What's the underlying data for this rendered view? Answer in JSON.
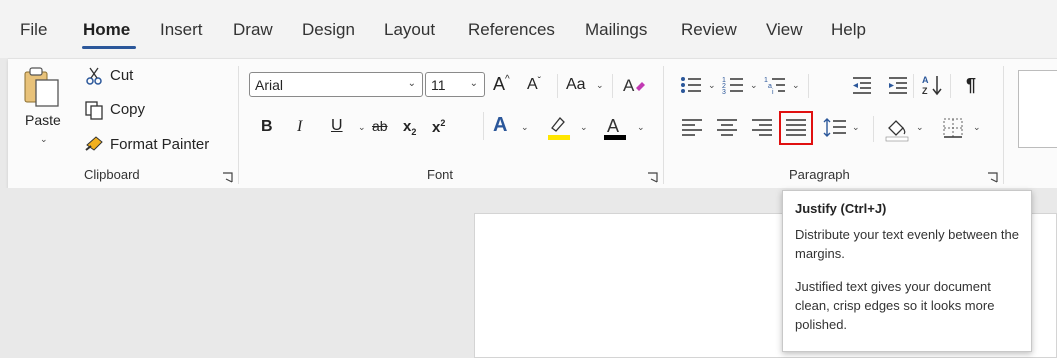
{
  "menu": {
    "tabs": [
      "File",
      "Home",
      "Insert",
      "Draw",
      "Design",
      "Layout",
      "References",
      "Mailings",
      "Review",
      "View",
      "Help"
    ],
    "active_tab": "Home"
  },
  "clipboard": {
    "paste_label": "Paste",
    "cut_label": "Cut",
    "copy_label": "Copy",
    "format_painter_label": "Format Painter",
    "group_label": "Clipboard"
  },
  "font": {
    "font_name": "Arial",
    "font_size": "11",
    "change_case_label": "Aa",
    "bold_label": "B",
    "italic_label": "I",
    "underline_label": "U",
    "strike_label": "ab",
    "subscript_label": "x",
    "superscript_label": "x",
    "group_label": "Font"
  },
  "paragraph": {
    "group_label": "Paragraph"
  },
  "tooltip": {
    "title": "Justify (Ctrl+J)",
    "line1": "Distribute your text evenly between the margins.",
    "line2": "Justified text gives your document clean, crisp edges so it looks more polished."
  },
  "colors": {
    "accent": "#2b579a",
    "highlight_box": "#e01010",
    "highlighter_yellow": "#ffe600",
    "font_color_red": "#000000"
  }
}
